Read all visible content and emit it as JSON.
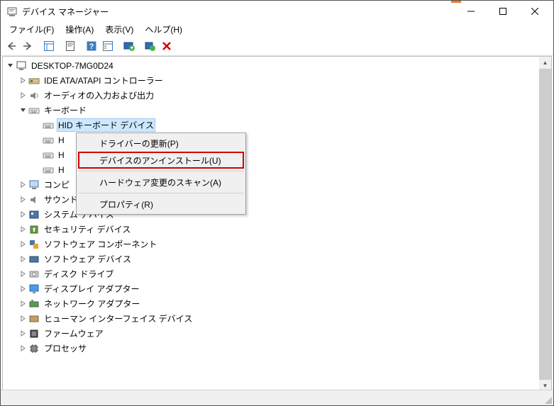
{
  "window": {
    "title": "デバイス マネージャー"
  },
  "menu": {
    "file": "ファイル(F)",
    "action": "操作(A)",
    "view": "表示(V)",
    "help": "ヘルプ(H)"
  },
  "tree": {
    "root": "DESKTOP-7MG0D24",
    "nodes": [
      {
        "label": "IDE ATA/ATAPI コントローラー",
        "icon": "ide",
        "expanded": false,
        "children": []
      },
      {
        "label": "オーディオの入力および出力",
        "icon": "audio",
        "expanded": false,
        "children": []
      },
      {
        "label": "キーボード",
        "icon": "keyboard",
        "expanded": true,
        "children": [
          {
            "label": "HID キーボード デバイス",
            "icon": "keyboard",
            "selected": true
          },
          {
            "label": "H",
            "icon": "keyboard"
          },
          {
            "label": "H",
            "icon": "keyboard"
          },
          {
            "label": "H",
            "icon": "keyboard"
          }
        ]
      },
      {
        "label": "コンピ",
        "icon": "computer",
        "expanded": false,
        "children": []
      },
      {
        "label": "サウンド、ビデオ、およびゲーム コントローラー",
        "icon": "sound",
        "expanded": false,
        "children": [],
        "partially_hidden": true
      },
      {
        "label": "システム デバイス",
        "icon": "system",
        "expanded": false,
        "children": []
      },
      {
        "label": "セキュリティ デバイス",
        "icon": "security",
        "expanded": false,
        "children": []
      },
      {
        "label": "ソフトウェア コンポーネント",
        "icon": "swcomp",
        "expanded": false,
        "children": []
      },
      {
        "label": "ソフトウェア デバイス",
        "icon": "swdev",
        "expanded": false,
        "children": []
      },
      {
        "label": "ディスク ドライブ",
        "icon": "disk",
        "expanded": false,
        "children": []
      },
      {
        "label": "ディスプレイ アダプター",
        "icon": "display",
        "expanded": false,
        "children": []
      },
      {
        "label": "ネットワーク アダプター",
        "icon": "network",
        "expanded": false,
        "children": []
      },
      {
        "label": "ヒューマン インターフェイス デバイス",
        "icon": "hid",
        "expanded": false,
        "children": []
      },
      {
        "label": "ファームウェア",
        "icon": "firmware",
        "expanded": false,
        "children": []
      },
      {
        "label": "プロセッサ",
        "icon": "cpu",
        "expanded": false,
        "children": []
      }
    ]
  },
  "context_menu": {
    "update_driver": "ドライバーの更新(P)",
    "uninstall_device": "デバイスのアンインストール(U)",
    "scan_hardware": "ハードウェア変更のスキャン(A)",
    "properties": "プロパティ(R)"
  }
}
